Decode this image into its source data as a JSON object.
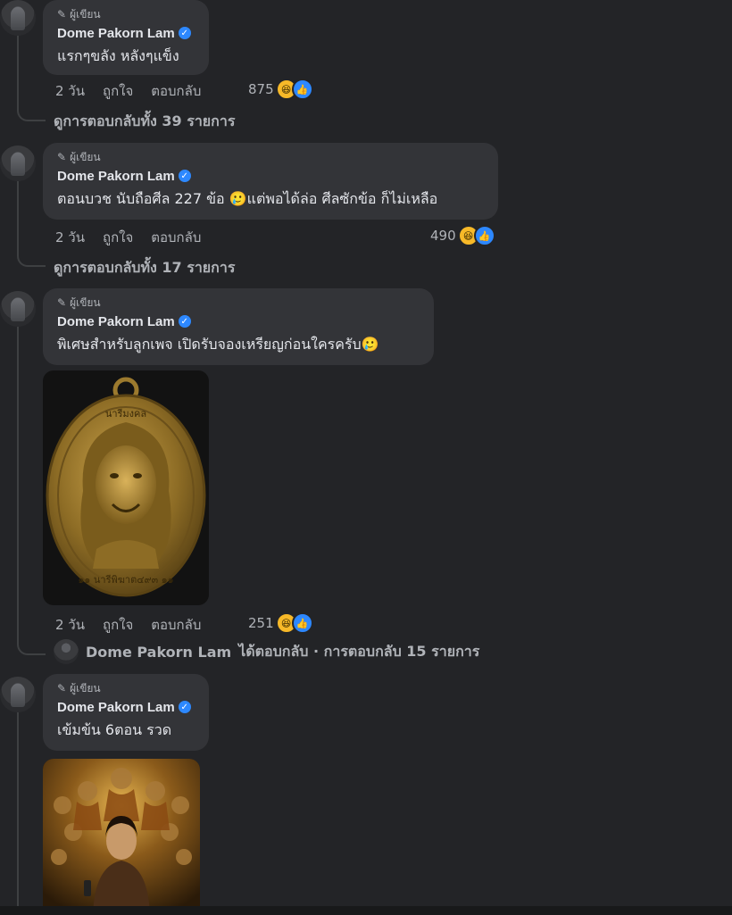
{
  "comments": [
    {
      "author_tag": "ผู้เขียน",
      "author": "Dome Pakorn Lam",
      "text": "แรกๆขลัง หลังๆแข็ง",
      "time": "2 วัน",
      "like": "ถูกใจ",
      "reply": "ตอบกลับ",
      "reaction_count": "875",
      "view_replies": "ดูการตอบกลับทั้ง 39 รายการ"
    },
    {
      "author_tag": "ผู้เขียน",
      "author": "Dome Pakorn Lam",
      "text": "ตอนบวช นับถือศีล 227 ข้อ 🥲แต่พอได้ล่อ ศีลซักข้อ ก็ไม่เหลือ",
      "time": "2 วัน",
      "like": "ถูกใจ",
      "reply": "ตอบกลับ",
      "reaction_count": "490",
      "view_replies": "ดูการตอบกลับทั้ง 17 รายการ"
    },
    {
      "author_tag": "ผู้เขียน",
      "author": "Dome Pakorn Lam",
      "text": "พิเศษสำหรับลูกเพจ เปิดรับจองเหรียญก่อนใครครับ🥲",
      "time": "2 วัน",
      "like": "ถูกใจ",
      "reply": "ตอบกลับ",
      "reaction_count": "251",
      "reply_summary_name": "Dome Pakorn Lam",
      "reply_summary_text": "ได้ตอบกลับ · การตอบกลับ 15 รายการ",
      "medal_top_text": "นารีมงคล",
      "medal_bottom_text": "๑๑ นารีพิฆาต๔๙๓ ๑๑"
    },
    {
      "author_tag": "ผู้เขียน",
      "author": "Dome Pakorn Lam",
      "text": "เข้มข้น 6ตอน รวด"
    }
  ],
  "icons": {
    "pencil": "pencil-icon",
    "verified": "verified-badge-icon",
    "haha": "haha-reaction-icon",
    "like": "like-reaction-icon"
  },
  "colors": {
    "background": "#232427",
    "bubble": "#333438",
    "verified": "#2d88ff",
    "haha": "#f7b928"
  }
}
